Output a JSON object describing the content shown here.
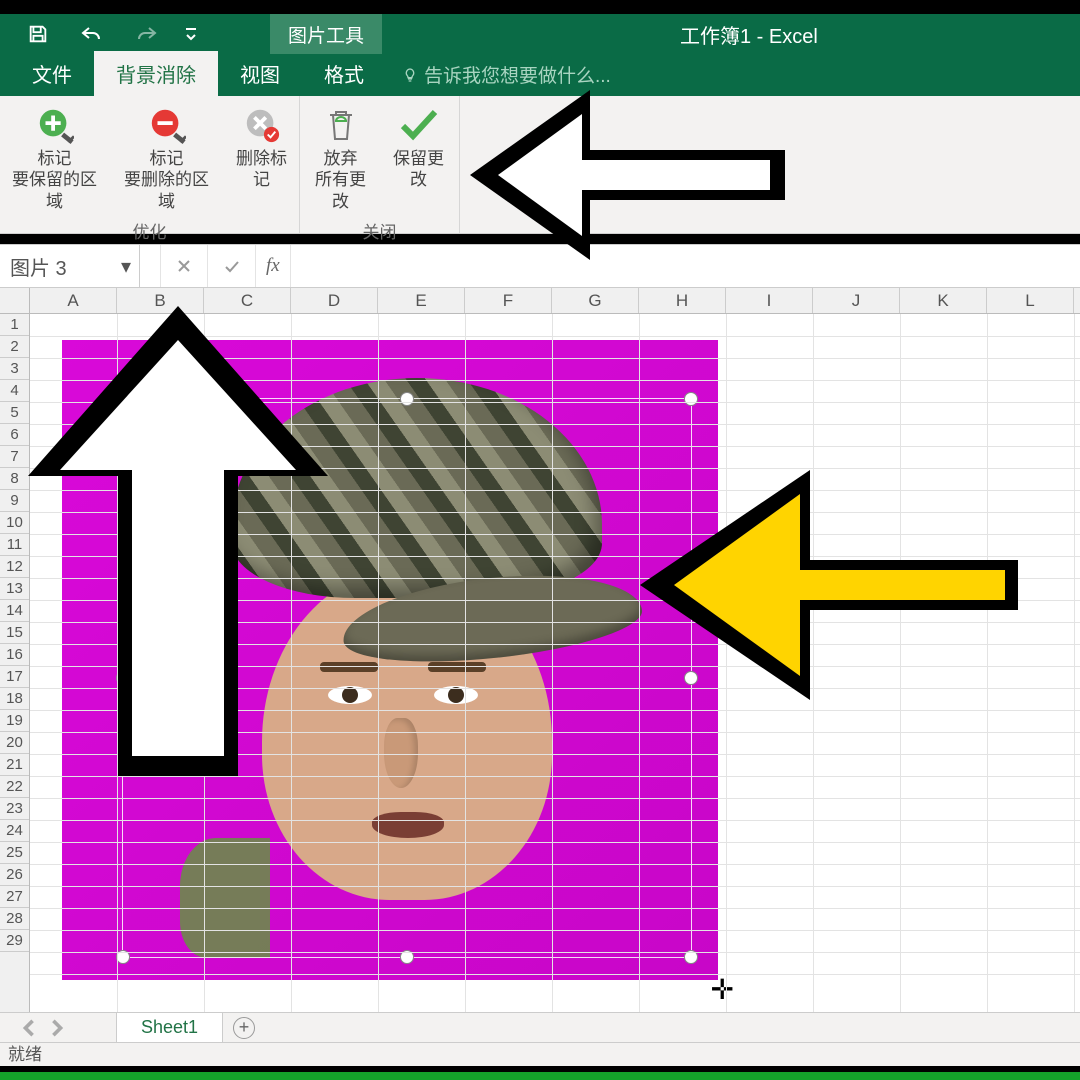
{
  "title": "工作簿1 - Excel",
  "context_tab": "图片工具",
  "tabs": {
    "file": "文件",
    "bgremove": "背景消除",
    "view": "视图",
    "format": "格式"
  },
  "tellme_placeholder": "告诉我您想要做什么...",
  "ribbon": {
    "group_optimize_label": "优化",
    "group_close_label": "关闭",
    "mark_keep_line1": "标记",
    "mark_keep_line2": "要保留的区域",
    "mark_remove_line1": "标记",
    "mark_remove_line2": "要删除的区域",
    "delete_mark": "删除标记",
    "discard_line1": "放弃",
    "discard_line2": "所有更改",
    "keep_changes": "保留更改"
  },
  "namebox_value": "图片 3",
  "fx_label": "fx",
  "columns": [
    "A",
    "B",
    "C",
    "D",
    "E",
    "F",
    "G",
    "H",
    "I",
    "J",
    "K",
    "L"
  ],
  "rows": [
    "1",
    "2",
    "3",
    "4",
    "5",
    "6",
    "7",
    "8",
    "9",
    "10",
    "11",
    "12",
    "13",
    "14",
    "15",
    "16",
    "17",
    "18",
    "19",
    "20",
    "21",
    "22",
    "23",
    "24",
    "25",
    "26",
    "27",
    "28",
    "29"
  ],
  "sheet_tab": "Sheet1",
  "status": "就绪",
  "icons": {
    "save": "save-icon",
    "undo": "undo-icon",
    "redo": "redo-icon",
    "customize": "customize-qat-icon",
    "plus": "plus-circle-icon",
    "minus": "minus-circle-icon",
    "x": "x-circle-icon",
    "trash": "trash-icon",
    "check": "check-icon",
    "lightbulb": "lightbulb-icon",
    "cancel": "cancel-icon",
    "enter": "enter-icon",
    "dropdown": "chevron-down-icon",
    "add-sheet": "plus-icon",
    "nav-prev": "chevron-left-icon",
    "nav-next": "chevron-right-icon"
  },
  "annotations": {
    "arrow_left_big": "annotation-arrow-left",
    "arrow_up_big": "annotation-arrow-up",
    "arrow_left_yellow": "annotation-arrow-left-yellow"
  }
}
